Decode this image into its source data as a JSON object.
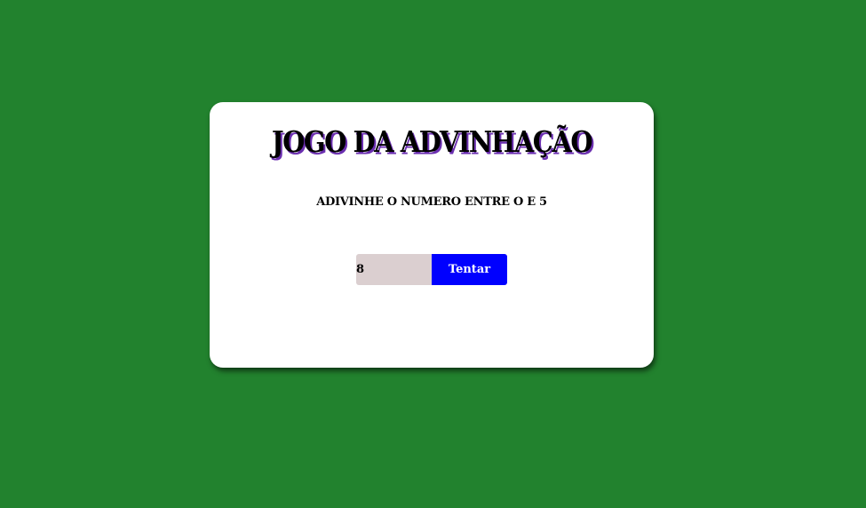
{
  "app": {
    "title": "JOGO DA ADVINHAÇÃO",
    "instruction": "ADIVINHE O NUMERO ENTRE O E 5"
  },
  "form": {
    "input_value": "8",
    "button_label": "Tentar"
  },
  "colors": {
    "background": "#22822e",
    "card": "#ffffff",
    "button": "#0000ff",
    "input": "#dbcfd0"
  }
}
